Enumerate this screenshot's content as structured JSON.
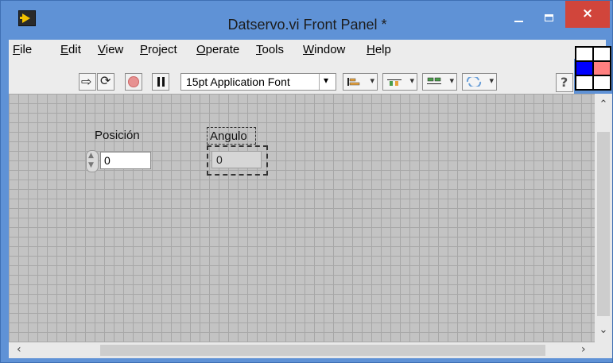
{
  "window": {
    "title": "Datservo.vi Front Panel *",
    "close_label": "×",
    "accent_color": "#5f92d6"
  },
  "menu": {
    "items": [
      {
        "label": "File",
        "key": "F",
        "rest": "ile"
      },
      {
        "label": "Edit",
        "key": "E",
        "rest": "dit"
      },
      {
        "label": "View",
        "key": "V",
        "rest": "iew"
      },
      {
        "label": "Project",
        "key": "P",
        "rest": "roject"
      },
      {
        "label": "Operate",
        "key": "O",
        "rest": "perate"
      },
      {
        "label": "Tools",
        "key": "T",
        "rest": "ools"
      },
      {
        "label": "Window",
        "key": "W",
        "rest": "indow"
      },
      {
        "label": "Help",
        "key": "H",
        "rest": "elp"
      }
    ]
  },
  "toolbar": {
    "font_selector": "15pt Application Font",
    "help_label": "?"
  },
  "controls": {
    "posicion": {
      "label": "Posición",
      "value": "0"
    },
    "angulo": {
      "label": "Angulo",
      "value": "0"
    }
  }
}
